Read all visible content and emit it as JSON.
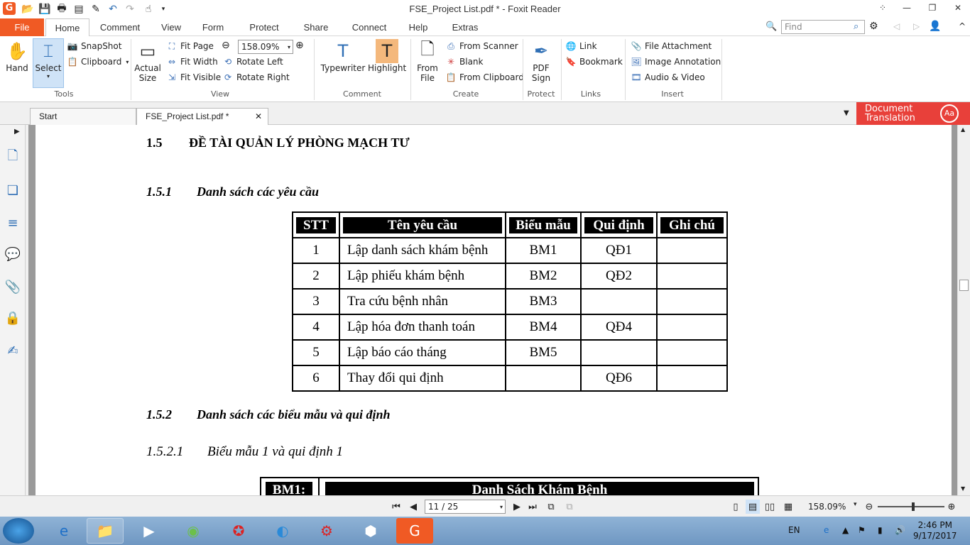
{
  "window": {
    "title": "FSE_Project List.pdf * - Foxit Reader"
  },
  "menu": {
    "file": "File",
    "tabs": [
      "Home",
      "Comment",
      "View",
      "Form",
      "Protect",
      "Share",
      "Connect",
      "Help",
      "Extras"
    ],
    "find_placeholder": "Find"
  },
  "ribbon": {
    "tools": {
      "hand": "Hand",
      "select": "Select",
      "snapshot": "SnapShot",
      "clipboard": "Clipboard",
      "group": "Tools"
    },
    "view": {
      "actual_size_1": "Actual",
      "actual_size_2": "Size",
      "fit_page": "Fit Page",
      "fit_width": "Fit Width",
      "fit_visible": "Fit Visible",
      "zoom": "158.09%",
      "rotate_left": "Rotate Left",
      "rotate_right": "Rotate Right",
      "group": "View"
    },
    "comment": {
      "typewriter": "Typewriter",
      "highlight": "Highlight",
      "group": "Comment"
    },
    "create": {
      "from_file_1": "From",
      "from_file_2": "File",
      "from_scanner": "From Scanner",
      "blank": "Blank",
      "from_clipboard": "From Clipboard",
      "group": "Create"
    },
    "protect": {
      "pdf_sign_1": "PDF",
      "pdf_sign_2": "Sign",
      "group": "Protect"
    },
    "links": {
      "link": "Link",
      "bookmark": "Bookmark",
      "group": "Links"
    },
    "insert": {
      "file_attachment": "File Attachment",
      "image_annotation": "Image Annotation",
      "audio_video": "Audio & Video",
      "group": "Insert"
    }
  },
  "tabs": {
    "start": "Start",
    "doc": "FSE_Project List.pdf *",
    "translate_1": "Document",
    "translate_2": "Translation"
  },
  "document": {
    "h1_num": "1.5",
    "h1_text": "ĐỀ TÀI QUẢN LÝ PHÒNG MẠCH TƯ",
    "h2a_num": "1.5.1",
    "h2a_text": "Danh sách các yêu cầu",
    "h2b_num": "1.5.2",
    "h2b_text": "Danh sách các biểu mẫu và qui định",
    "h3_num": "1.5.2.1",
    "h3_text": "Biểu mẫu 1 và qui định 1",
    "table": {
      "headers": [
        "STT",
        "Tên yêu cầu",
        "Biểu mẫu",
        "Qui định",
        "Ghi chú"
      ],
      "rows": [
        [
          "1",
          "Lập danh sách khám bệnh",
          "BM1",
          "QĐ1",
          ""
        ],
        [
          "2",
          "Lập phiếu khám bệnh",
          "BM2",
          "QĐ2",
          ""
        ],
        [
          "3",
          "Tra cứu bệnh nhân",
          "BM3",
          "",
          ""
        ],
        [
          "4",
          "Lập hóa đơn thanh toán",
          "BM4",
          "QĐ4",
          ""
        ],
        [
          "5",
          "Lập báo cáo tháng",
          "BM5",
          "",
          ""
        ],
        [
          "6",
          "Thay đổi qui định",
          "",
          "QĐ6",
          ""
        ]
      ]
    },
    "bm_label": "BM1:",
    "bm_title": "Danh Sách Khám Bệnh"
  },
  "status": {
    "page": "11 / 25",
    "zoom": "158.09%"
  },
  "taskbar": {
    "lang": "EN",
    "time": "2:46 PM",
    "date": "9/17/2017"
  }
}
